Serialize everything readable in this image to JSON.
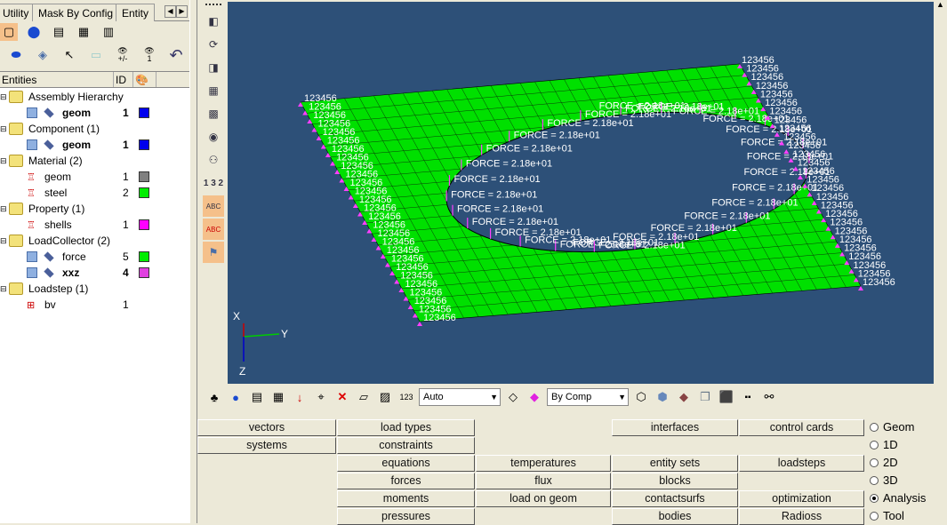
{
  "tabs": [
    "Utility",
    "Mask By Config",
    "Entity"
  ],
  "tree": {
    "headers": {
      "entities": "Entities",
      "id": "ID"
    },
    "rows": [
      {
        "label": "Assembly Hierarchy",
        "type": "folder",
        "level": 0
      },
      {
        "label": "geom",
        "type": "comp",
        "level": 1,
        "id": "1",
        "color": "#0000ee",
        "bold": true
      },
      {
        "label": "Component (1)",
        "type": "folder",
        "level": 0
      },
      {
        "label": "geom",
        "type": "comp",
        "level": 1,
        "id": "1",
        "color": "#0000ee",
        "bold": true
      },
      {
        "label": "Material (2)",
        "type": "folder",
        "level": 0
      },
      {
        "label": "geom",
        "type": "mat",
        "level": 1,
        "id": "1",
        "color": "#808080"
      },
      {
        "label": "steel",
        "type": "mat",
        "level": 1,
        "id": "2",
        "color": "#00ee00"
      },
      {
        "label": "Property (1)",
        "type": "folder",
        "level": 0
      },
      {
        "label": "shells",
        "type": "prop",
        "level": 1,
        "id": "1",
        "color": "#ff00ff"
      },
      {
        "label": "LoadCollector (2)",
        "type": "folder",
        "level": 0
      },
      {
        "label": "force",
        "type": "comp",
        "level": 1,
        "id": "5",
        "color": "#00ee00"
      },
      {
        "label": "xxz",
        "type": "comp",
        "level": 1,
        "id": "4",
        "color": "#e040e0",
        "bold": true
      },
      {
        "label": "Loadstep (1)",
        "type": "folder",
        "level": 0
      },
      {
        "label": "bv",
        "type": "step",
        "level": 1,
        "id": "1"
      }
    ]
  },
  "icon_labels": {
    "hide_show": "+/-",
    "show_one": "1"
  },
  "viewport": {
    "constraint_label": "123456",
    "force_label": "FORCE = 2.18e+01",
    "axis_x": "X",
    "axis_y": "Y",
    "axis_z": "Z",
    "bg": "#2d5078",
    "mesh": "#00e000"
  },
  "vtool_labels": {
    "numbering": "1 3 2",
    "abc1": "ABC",
    "abc2": "ABC"
  },
  "htool": {
    "mode_select": "Auto",
    "color_select": "By Comp"
  },
  "panel": {
    "buttons": [
      [
        "vectors",
        "load types",
        "",
        "interfaces",
        "control cards"
      ],
      [
        "systems",
        "constraints",
        "",
        "",
        ""
      ],
      [
        "",
        "equations",
        "temperatures",
        "entity sets",
        "loadsteps"
      ],
      [
        "",
        "forces",
        "flux",
        "blocks",
        ""
      ],
      [
        "",
        "moments",
        "load on geom",
        "contactsurfs",
        "optimization"
      ],
      [
        "",
        "pressures",
        "",
        "bodies",
        "Radioss"
      ]
    ],
    "radios": [
      {
        "label": "Geom",
        "on": false
      },
      {
        "label": "1D",
        "on": false
      },
      {
        "label": "2D",
        "on": false
      },
      {
        "label": "3D",
        "on": false
      },
      {
        "label": "Analysis",
        "on": true
      },
      {
        "label": "Tool",
        "on": false
      }
    ]
  }
}
